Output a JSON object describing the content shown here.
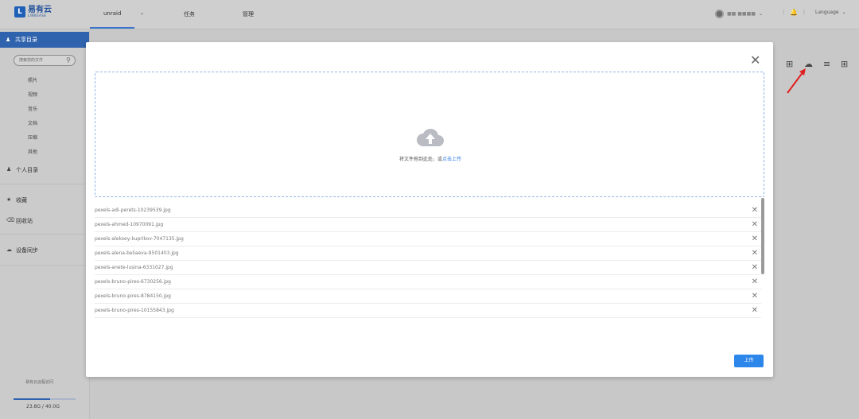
{
  "header": {
    "logo_text": "易有云",
    "logo_sub": "LINKEASE",
    "tabs": [
      "unraid",
      "任务",
      "管理"
    ],
    "user_text": "■■ ■■■■",
    "language": "Language"
  },
  "sidebar": {
    "active_item": "共享目录",
    "search_placeholder": "搜索您的文件",
    "sub_items": [
      "照片",
      "视频",
      "音乐",
      "文档",
      "压缩",
      "其他"
    ],
    "items": [
      "个人目录",
      "收藏",
      "回收站",
      "设备同步"
    ],
    "remote_access": "易有云远程访问",
    "storage": {
      "text": "23.8G / 40.0G",
      "used_fraction": 0.595
    }
  },
  "modal": {
    "drop_text": "将文件拖到此处，或",
    "drop_link": "点击上传",
    "upload_button": "上传",
    "files": [
      "pexels-adi-perets-10239539.jpg",
      "pexels-ahmed-10970091.jpg",
      "pexels-aleksey-kuprikov-7047135.jpg",
      "pexels-alena-beliaeva-9501403.jpg",
      "pexels-anete-lusina-6331027.jpg",
      "pexels-bruno-pires-6730256.jpg",
      "pexels-bruno-pires-8784150.jpg",
      "pexels-bruno-pires-10155843.jpg"
    ]
  },
  "colors": {
    "accent": "#2d86ea",
    "sidebar_active": "#2f63ad",
    "annotation_arrow": "#e02020"
  }
}
